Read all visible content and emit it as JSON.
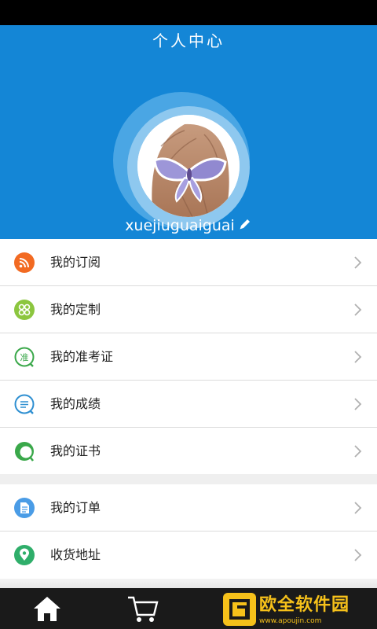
{
  "header": {
    "title": "个人中心",
    "username": "xuejiuguaiguai"
  },
  "menu_group_1": [
    {
      "label": "我的订阅",
      "icon": "rss-icon",
      "color": "#f26a22"
    },
    {
      "label": "我的定制",
      "icon": "customize-icon",
      "color": "#8cc63f"
    },
    {
      "label": "我的准考证",
      "icon": "admission-ticket-icon",
      "color": "#3aa84a"
    },
    {
      "label": "我的成绩",
      "icon": "score-icon",
      "color": "#2e8fd1"
    },
    {
      "label": "我的证书",
      "icon": "certificate-icon",
      "color": "#3aa84a"
    }
  ],
  "menu_group_2": [
    {
      "label": "我的订单",
      "icon": "order-icon",
      "color": "#4a9ce6"
    },
    {
      "label": "收货地址",
      "icon": "location-icon",
      "color": "#2fae6a"
    }
  ],
  "ticket_icon_char": "准",
  "tabbar": [
    {
      "name": "home-icon"
    },
    {
      "name": "cart-icon"
    },
    {
      "name": "user-icon"
    }
  ],
  "watermark": {
    "text": "欧全软件园",
    "url": "www.apoujin.com"
  },
  "colors": {
    "header_bg": "#1486d6",
    "tabbar_bg": "#1a1a1a",
    "watermark": "#f6c11a"
  }
}
